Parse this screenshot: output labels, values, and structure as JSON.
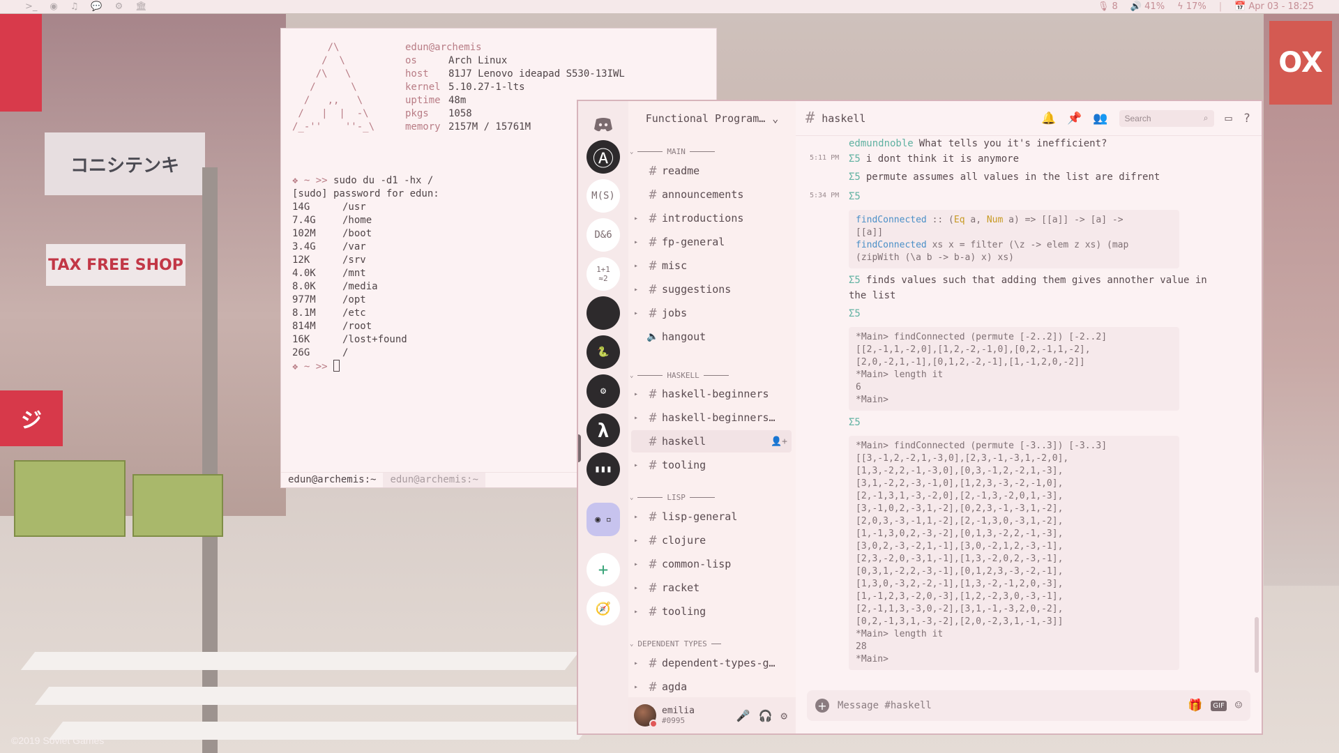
{
  "topbar": {
    "left_icons": [
      "terminal-icon",
      "firefox-icon",
      "music-icon",
      "chat-icon",
      "settings-icon",
      "bank-icon"
    ],
    "mic": "8",
    "volume": "41%",
    "battery": "17%",
    "datetime": "Apr 03 - 18:25"
  },
  "wallpaper": {
    "copyright": "©2019 Soviet Games"
  },
  "terminal": {
    "logo": "      /\\\n     /  \\\n    /\\   \\\n   /      \\\n  /   ,,   \\\n /   |  |  -\\\n/_-''    ''-_\\",
    "user_host": "edun@archemis",
    "info": [
      {
        "key": "os",
        "value": "Arch Linux"
      },
      {
        "key": "host",
        "value": "81J7 Lenovo ideapad S530-13IWL"
      },
      {
        "key": "kernel",
        "value": "5.10.27-1-lts"
      },
      {
        "key": "uptime",
        "value": "48m"
      },
      {
        "key": "pkgs",
        "value": "1058"
      },
      {
        "key": "memory",
        "value": "2157M / 15761M"
      }
    ],
    "prompt": "❖ ~ >>",
    "command": "sudo du -d1 -hx /",
    "sudo_line": "[sudo] password for edun:",
    "du": [
      {
        "size": "14G",
        "path": "/usr"
      },
      {
        "size": "7.4G",
        "path": "/home"
      },
      {
        "size": "102M",
        "path": "/boot"
      },
      {
        "size": "3.4G",
        "path": "/var"
      },
      {
        "size": "12K",
        "path": "/srv"
      },
      {
        "size": "4.0K",
        "path": "/mnt"
      },
      {
        "size": "8.0K",
        "path": "/media"
      },
      {
        "size": "977M",
        "path": "/opt"
      },
      {
        "size": "8.1M",
        "path": "/etc"
      },
      {
        "size": "814M",
        "path": "/root"
      },
      {
        "size": "16K",
        "path": "/lost+found"
      },
      {
        "size": "26G",
        "path": "/"
      }
    ],
    "tabs": [
      "edun@archemis:~",
      "edun@archemis:~"
    ]
  },
  "discord": {
    "server_name": "Functional Program…",
    "guilds": [
      {
        "label": "Ⓐ",
        "style": "dark",
        "name": "guild-avengers"
      },
      {
        "label": "M(S)",
        "style": "light",
        "name": "guild-ms"
      },
      {
        "label": "D&6",
        "style": "light",
        "name": "guild-d6"
      },
      {
        "label": "1+1 ≈2",
        "style": "light",
        "name": "guild-math"
      },
      {
        "label": "",
        "style": "dark",
        "name": "guild-ring"
      },
      {
        "label": "🐍",
        "style": "dark",
        "name": "guild-python"
      },
      {
        "label": "⚙",
        "style": "dark",
        "name": "guild-gear"
      },
      {
        "label": "λ",
        "style": "dark",
        "name": "guild-lambda"
      },
      {
        "label": "▮▮▮",
        "style": "dark",
        "name": "guild-books"
      }
    ],
    "categories": {
      "main": "MAIN",
      "haskell": "HASKELL",
      "lisp": "LISP",
      "dependent": "DEPENDENT TYPES"
    },
    "channels": {
      "main": [
        {
          "name": "readme",
          "type": "text",
          "arrow": false
        },
        {
          "name": "announcements",
          "type": "text",
          "arrow": false
        },
        {
          "name": "introductions",
          "type": "text",
          "arrow": true
        },
        {
          "name": "fp-general",
          "type": "text",
          "arrow": true
        },
        {
          "name": "misc",
          "type": "text",
          "arrow": true
        },
        {
          "name": "suggestions",
          "type": "text",
          "arrow": true
        },
        {
          "name": "jobs",
          "type": "text",
          "arrow": true
        },
        {
          "name": "hangout",
          "type": "voice",
          "arrow": false
        }
      ],
      "haskell": [
        {
          "name": "haskell-beginners",
          "type": "text",
          "arrow": true
        },
        {
          "name": "haskell-beginners-m…",
          "type": "text",
          "arrow": true
        },
        {
          "name": "haskell",
          "type": "text",
          "arrow": false,
          "selected": true
        },
        {
          "name": "tooling",
          "type": "text",
          "arrow": true
        }
      ],
      "lisp": [
        {
          "name": "lisp-general",
          "type": "text",
          "arrow": true
        },
        {
          "name": "clojure",
          "type": "text",
          "arrow": true
        },
        {
          "name": "common-lisp",
          "type": "text",
          "arrow": true
        },
        {
          "name": "racket",
          "type": "text",
          "arrow": true
        },
        {
          "name": "tooling",
          "type": "text",
          "arrow": true
        }
      ],
      "dependent": [
        {
          "name": "dependent-types-gen…",
          "type": "text",
          "arrow": true
        },
        {
          "name": "agda",
          "type": "text",
          "arrow": true
        }
      ]
    },
    "user": {
      "name": "emilia",
      "tag": "#0995"
    },
    "chat": {
      "channel": "haskell",
      "search_placeholder": "Search",
      "composer_placeholder": "Message #haskell",
      "messages": {
        "m0_author": "edmundnoble",
        "m0_text": "What tells you it's inefficient?",
        "m1_time": "5:11 PM",
        "sig": "Σ5",
        "m1_text": "i dont think it is anymore",
        "m2_text": "permute assumes all values in the list are difrent",
        "m3_time": "5:34 PM",
        "code1_fn1": "findConnected",
        "code1_l1a": " :: (",
        "code1_ty1": "Eq",
        "code1_l1b": " a, ",
        "code1_ty2": "Num",
        "code1_l1c": " a) => [[a]] -> [a] ->\n[[a]]",
        "code1_fn2": "findConnected",
        "code1_l2": " xs x = filter (\\z -> elem z xs) (map\n(zipWith (\\a b -> b-a) x) xs)",
        "m4_text": "finds values such that adding them gives annother value in the list",
        "code2": "*Main> findConnected (permute [-2..2]) [-2..2]\n[[2,-1,1,-2,0],[1,2,-2,-1,0],[0,2,-1,1,-2],\n[2,0,-2,1,-1],[0,1,2,-2,-1],[1,-1,2,0,-2]]\n*Main> length it\n6\n*Main>",
        "code3": "*Main> findConnected (permute [-3..3]) [-3..3]\n[[3,-1,2,-2,1,-3,0],[2,3,-1,-3,1,-2,0],\n[1,3,-2,2,-1,-3,0],[0,3,-1,2,-2,1,-3],\n[3,1,-2,2,-3,-1,0],[1,2,3,-3,-2,-1,0],\n[2,-1,3,1,-3,-2,0],[2,-1,3,-2,0,1,-3],\n[3,-1,0,2,-3,1,-2],[0,2,3,-1,-3,1,-2],\n[2,0,3,-3,-1,1,-2],[2,-1,3,0,-3,1,-2],\n[1,-1,3,0,2,-3,-2],[0,1,3,-2,2,-1,-3],\n[3,0,2,-3,-2,1,-1],[3,0,-2,1,2,-3,-1],\n[2,3,-2,0,-3,1,-1],[1,3,-2,0,2,-3,-1],\n[0,3,1,-2,2,-3,-1],[0,1,2,3,-3,-2,-1],\n[1,3,0,-3,2,-2,-1],[1,3,-2,-1,2,0,-3],\n[1,-1,2,3,-2,0,-3],[1,2,-2,3,0,-3,-1],\n[2,-1,1,3,-3,0,-2],[3,1,-1,-3,2,0,-2],\n[0,2,-1,3,1,-3,-2],[2,0,-2,3,1,-1,-3]]\n*Main> length it\n28\n*Main>"
      }
    }
  }
}
